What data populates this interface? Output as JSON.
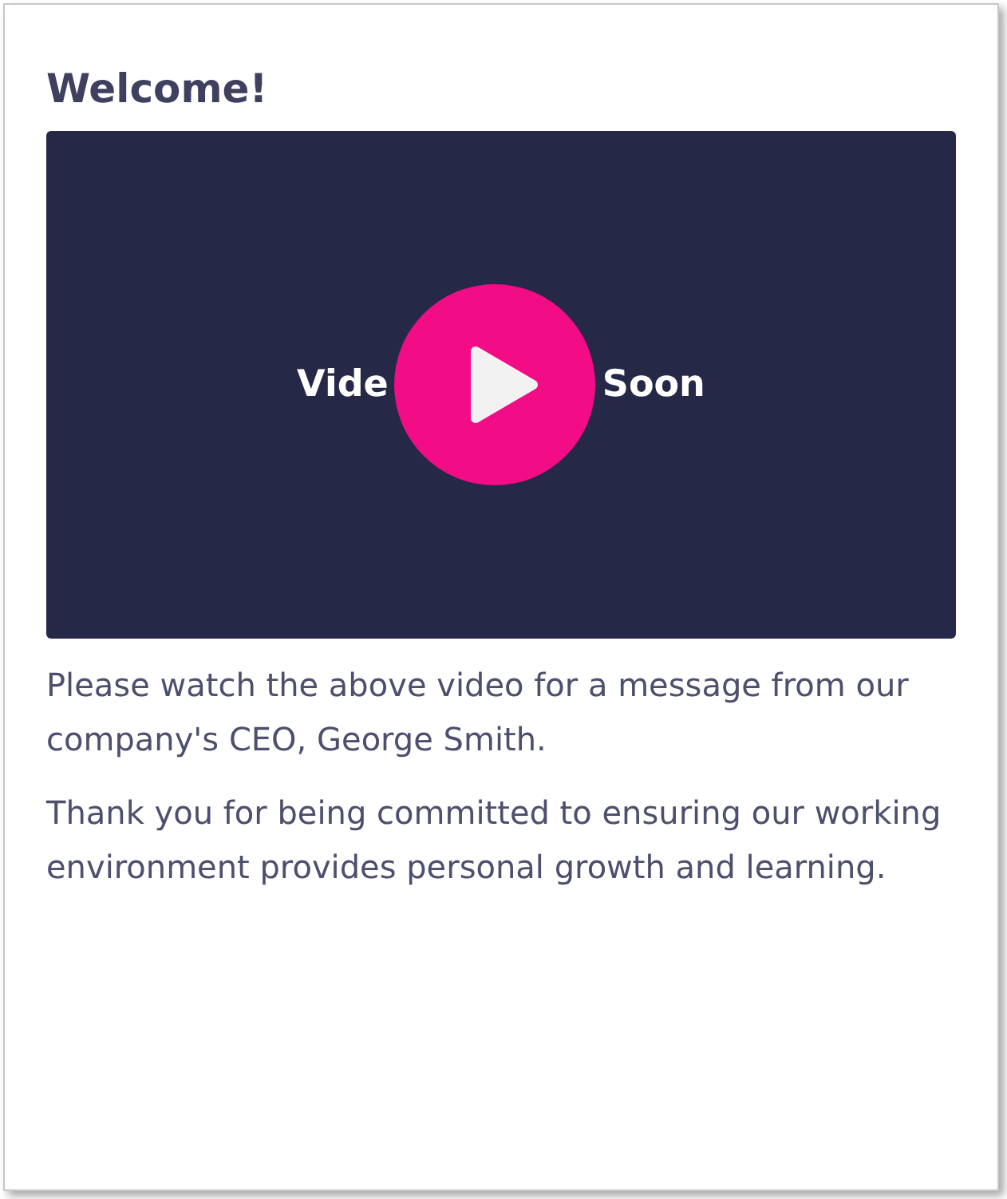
{
  "title": "Welcome!",
  "video": {
    "caption_before": "Vide",
    "caption_after": "Soon"
  },
  "paragraphs": [
    "Please watch the above video for a message from our company's CEO, George Smith.",
    "Thank you for being committed to ensuring our working environment provides personal growth and learning."
  ]
}
